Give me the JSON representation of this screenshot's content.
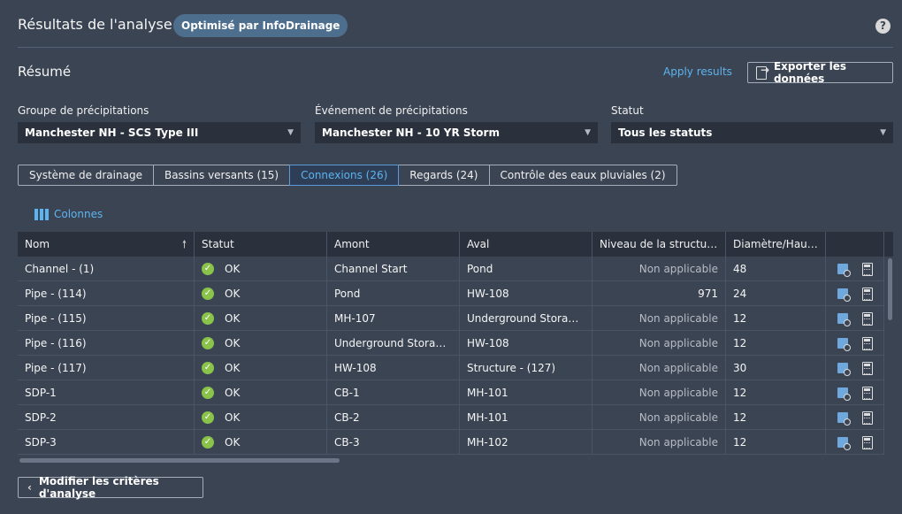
{
  "header": {
    "title": "Résultats de l'analyse",
    "badge": "Optimisé par InfoDrainage",
    "help": "?"
  },
  "summary": {
    "title": "Résumé",
    "apply_label": "Apply results",
    "export_label": "Exporter les données"
  },
  "filters": {
    "group_label": "Groupe de précipitations",
    "group_value": "Manchester NH - SCS Type III",
    "event_label": "Événement de précipitations",
    "event_value": "Manchester NH - 10 YR Storm",
    "status_label": "Statut",
    "status_value": "Tous les statuts"
  },
  "tabs": [
    {
      "label": "Système de drainage"
    },
    {
      "label": "Bassins versants (15)"
    },
    {
      "label": "Connexions (26)"
    },
    {
      "label": "Regards (24)"
    },
    {
      "label": "Contrôle des eaux pluviales (2)"
    }
  ],
  "columns_label": "Colonnes",
  "table": {
    "headers": [
      "Nom",
      "Statut",
      "Amont",
      "Aval",
      "Niveau de la structure en aval",
      "Diamètre/Hauteur"
    ],
    "rows": [
      {
        "name": "Channel - (1)",
        "status": "OK",
        "up": "Channel Start",
        "down": "Pond",
        "level": "Non applicable",
        "dia": "48"
      },
      {
        "name": "Pipe - (114)",
        "status": "OK",
        "up": "Pond",
        "down": "HW-108",
        "level": "971",
        "dia": "24"
      },
      {
        "name": "Pipe - (115)",
        "status": "OK",
        "up": "MH-107",
        "down": "Underground Storage ...",
        "level": "Non applicable",
        "dia": "12"
      },
      {
        "name": "Pipe - (116)",
        "status": "OK",
        "up": "Underground Storage ...",
        "down": "HW-108",
        "level": "Non applicable",
        "dia": "12"
      },
      {
        "name": "Pipe - (117)",
        "status": "OK",
        "up": "HW-108",
        "down": "Structure - (127)",
        "level": "Non applicable",
        "dia": "30"
      },
      {
        "name": "SDP-1",
        "status": "OK",
        "up": "CB-1",
        "down": "MH-101",
        "level": "Non applicable",
        "dia": "12"
      },
      {
        "name": "SDP-2",
        "status": "OK",
        "up": "CB-2",
        "down": "MH-101",
        "level": "Non applicable",
        "dia": "12"
      },
      {
        "name": "SDP-3",
        "status": "OK",
        "up": "CB-3",
        "down": "MH-102",
        "level": "Non applicable",
        "dia": "12"
      }
    ]
  },
  "footer": {
    "modify_label": "Modifier les critères d'analyse"
  }
}
